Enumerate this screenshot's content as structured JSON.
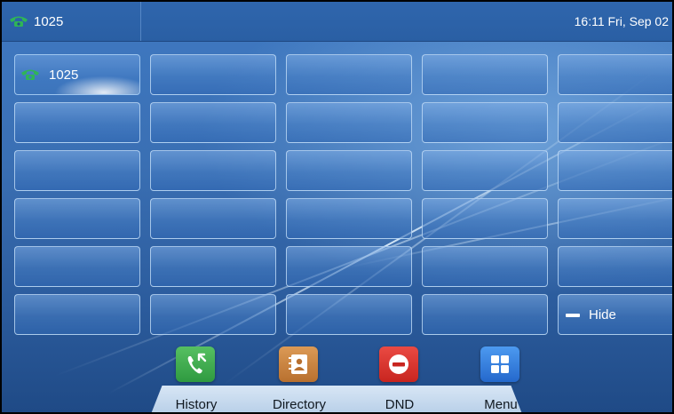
{
  "status_bar": {
    "line_label": "1025",
    "datetime": "16:11 Fri, Sep 02"
  },
  "line_keys": {
    "active_label": "1025",
    "hide_label": "Hide"
  },
  "softkeys": [
    {
      "label": "History",
      "icon": "history-icon",
      "color": "#3aa34a"
    },
    {
      "label": "Directory",
      "icon": "directory-icon",
      "color": "#c9823e"
    },
    {
      "label": "DND",
      "icon": "dnd-icon",
      "color": "#d8322e"
    },
    {
      "label": "Menu",
      "icon": "menu-icon",
      "color": "#2f7fde"
    }
  ],
  "colors": {
    "registered_phone": "#2fb457",
    "wallpaper_blue": "#3a6fb3"
  }
}
